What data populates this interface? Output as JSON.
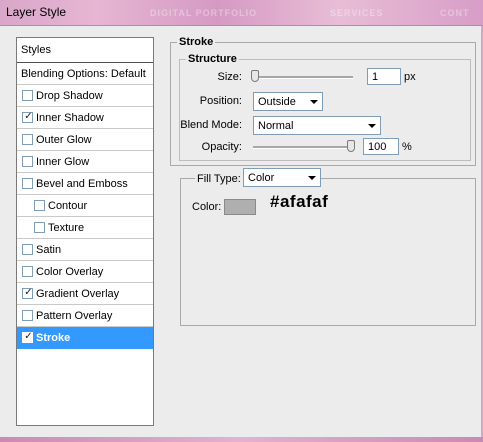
{
  "window": {
    "title": "Layer Style",
    "background_labels": [
      "DIGITAL PORTFOLIO",
      "SERVICES",
      "CONT"
    ]
  },
  "styles_list": {
    "header": "Styles",
    "blending": "Blending Options: Default",
    "items": [
      {
        "label": "Drop Shadow",
        "checked": false
      },
      {
        "label": "Inner Shadow",
        "checked": true
      },
      {
        "label": "Outer Glow",
        "checked": false
      },
      {
        "label": "Inner Glow",
        "checked": false
      },
      {
        "label": "Bevel and Emboss",
        "checked": false
      },
      {
        "label": "Contour",
        "checked": false
      },
      {
        "label": "Texture",
        "checked": false
      },
      {
        "label": "Satin",
        "checked": false
      },
      {
        "label": "Color Overlay",
        "checked": false
      },
      {
        "label": "Gradient Overlay",
        "checked": true
      },
      {
        "label": "Pattern Overlay",
        "checked": false
      },
      {
        "label": "Stroke",
        "checked": true
      }
    ],
    "selected": "Stroke",
    "check_glyph": "✓"
  },
  "stroke": {
    "group_title": "Stroke",
    "structure_title": "Structure",
    "size_label": "Size:",
    "size_value": "1",
    "size_unit": "px",
    "size_slider_level": 0.01,
    "position_label": "Position:",
    "position_value": "Outside",
    "blend_label": "Blend Mode:",
    "blend_value": "Normal",
    "opacity_label": "Opacity:",
    "opacity_value": "100",
    "opacity_unit": "%",
    "opacity_slider_level": 1.0,
    "fill_type_label": "Fill Type:",
    "fill_type_value": "Color",
    "color_label": "Color:",
    "color_swatch": "#afafaf",
    "color_annotation": "#afafaf"
  }
}
